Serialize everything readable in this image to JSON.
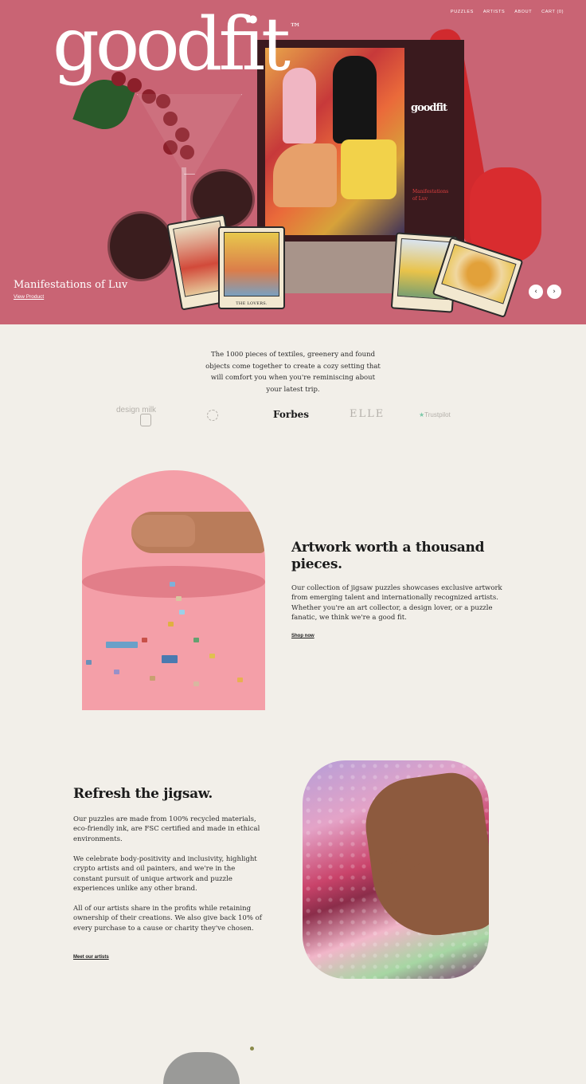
{
  "nav": {
    "puzzles": "PUZZLES",
    "artists": "ARTISTS",
    "about": "ABOUT",
    "cart": "CART (0)"
  },
  "brand": {
    "logo": "goodfit",
    "trademark": "™"
  },
  "hero": {
    "title": "Manifestations of Luv",
    "link": "View Product",
    "prev_icon": "chevron-left-icon",
    "next_icon": "chevron-right-icon",
    "box_logo": "goodfit",
    "box_title": "Manifestations of Luv",
    "card_left": "THE LOVERS.",
    "background": "#c96474"
  },
  "press": {
    "text": "The 1000 pieces of textiles, greenery and found objects come together to create a cozy setting that will comfort you when you're reminiscing about your latest trip.",
    "logos": {
      "designmilk": "design milk",
      "forbes": "Forbes",
      "elle": "ELLE",
      "trustpilot": "Trustpilot"
    }
  },
  "section1": {
    "title": "Artwork worth a thousand pieces.",
    "body": "Our collection of jigsaw puzzles showcases exclusive artwork from emerging talent and internationally recognized artists. Whether you're an art collector, a design lover, or a puzzle fanatic, we think we're a good fit.",
    "link": "Shop now"
  },
  "section2": {
    "title": "Refresh the jigsaw.",
    "p1": "Our puzzles are made from 100% recycled materials, eco-friendly ink, are FSC certified and made in ethical environments.",
    "p2": "We celebrate body-positivity and inclusivity, highlight crypto artists and oil painters, and we're in the constant pursuit of unique artwork and puzzle experiences unlike any other brand.",
    "p3": "All of our artists share in the profits while retaining ownership of their creations. We also give back 10% of every purchase to a cause or charity they've chosen.",
    "link": "Meet our artists"
  },
  "colors": {
    "page_bg": "#f2efe9",
    "arch_pink": "#f49fa8"
  }
}
